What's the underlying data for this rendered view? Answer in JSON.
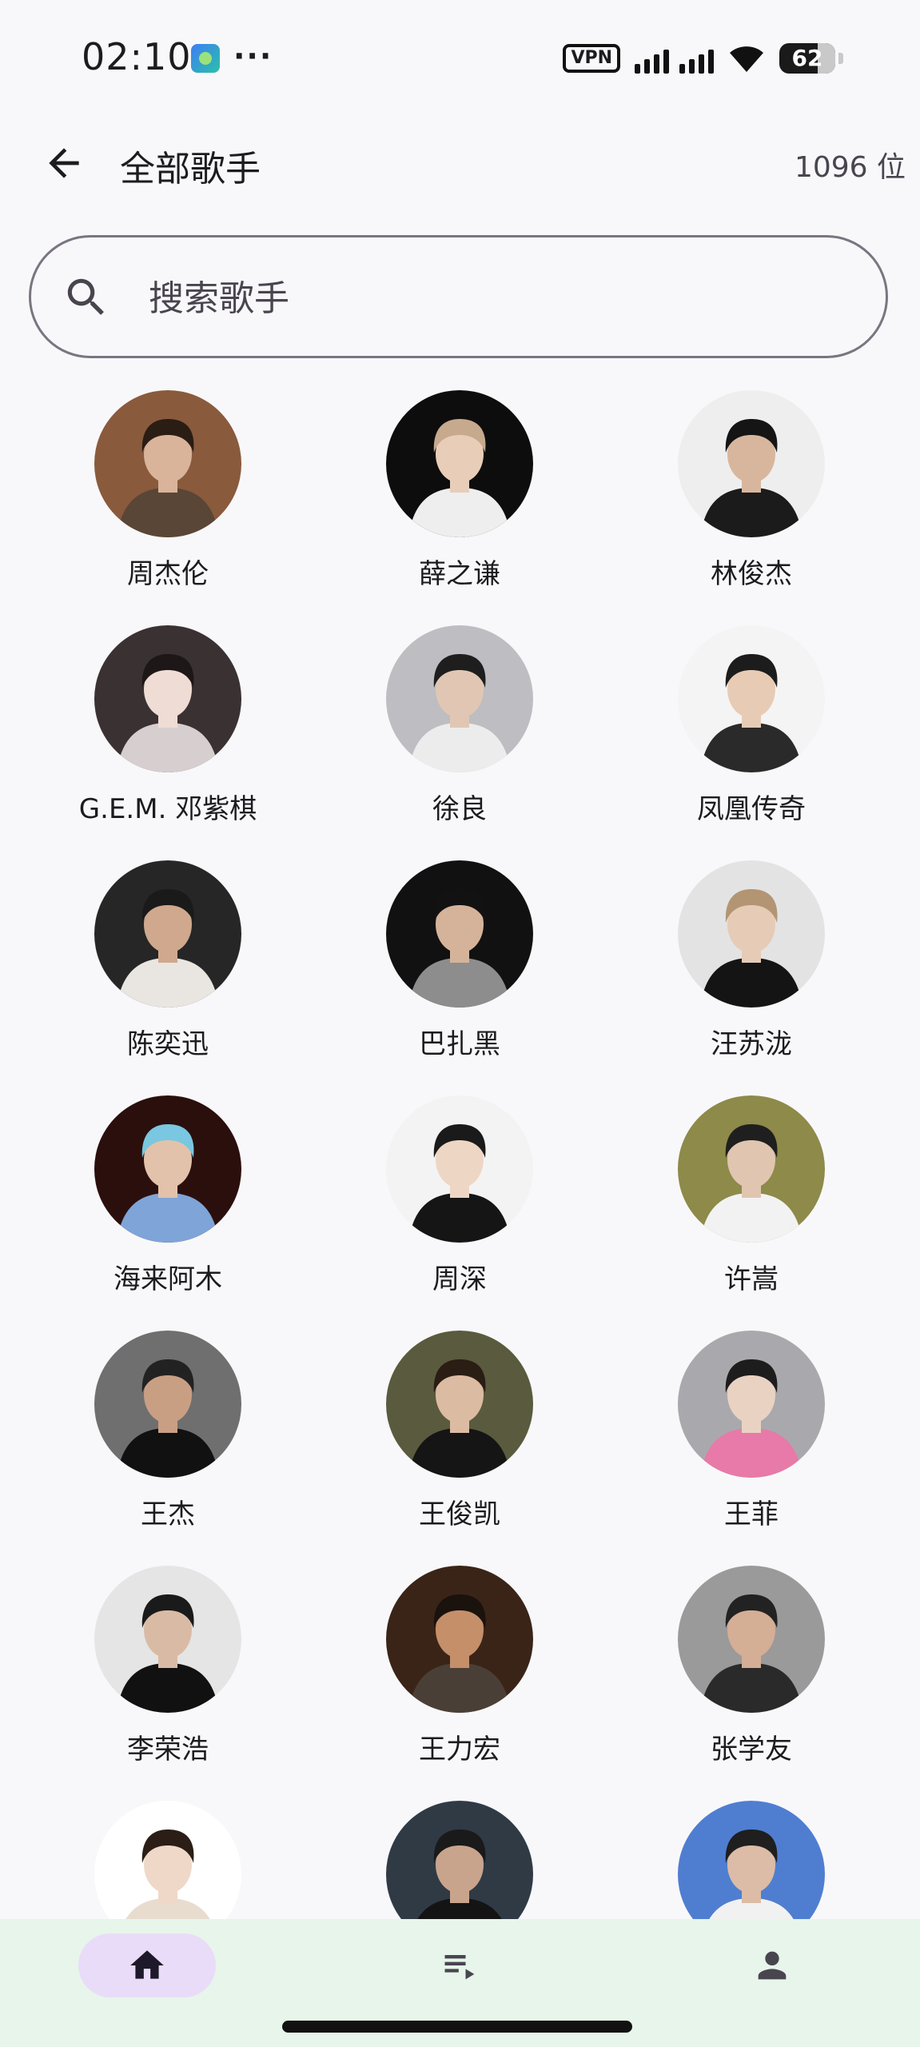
{
  "status_bar": {
    "time": "02:10",
    "more": "···",
    "vpn": "VPN",
    "battery": "62"
  },
  "header": {
    "title": "全部歌手",
    "count": "1096 位"
  },
  "search": {
    "placeholder": "搜索歌手",
    "value": ""
  },
  "artists": [
    {
      "name": "周杰伦",
      "bg": "#8a5a3c",
      "body": "#5a4636",
      "hair": "#2a1d14",
      "skin": "#d9b49a"
    },
    {
      "name": "薛之谦",
      "bg": "#0d0d0d",
      "body": "#eeeeee",
      "hair": "#c7a98d",
      "skin": "#e8cdb8"
    },
    {
      "name": "林俊杰",
      "bg": "#eeeeee",
      "body": "#1b1b1b",
      "hair": "#151515",
      "skin": "#d8b69e"
    },
    {
      "name": "G.E.M. 邓紫棋",
      "bg": "#3a3133",
      "body": "#d7cfcf",
      "hair": "#1d1718",
      "skin": "#efdcd4"
    },
    {
      "name": "徐良",
      "bg": "#bdbdc2",
      "body": "#ececec",
      "hair": "#1e1e1e",
      "skin": "#e1c7b3"
    },
    {
      "name": "凤凰传奇",
      "bg": "#f4f4f4",
      "body": "#2a2a2a",
      "hair": "#1c1c1c",
      "skin": "#e8cbb5"
    },
    {
      "name": "陈奕迅",
      "bg": "#262626",
      "body": "#e9e6e1",
      "hair": "#1a1a1a",
      "skin": "#cfa88e"
    },
    {
      "name": "巴扎黑",
      "bg": "#111111",
      "body": "#8d8d8d",
      "hair": "#121212",
      "skin": "#d5b39a"
    },
    {
      "name": "汪苏泷",
      "bg": "#e3e3e3",
      "body": "#141414",
      "hair": "#b39574",
      "skin": "#e6cbb6"
    },
    {
      "name": "海来阿木",
      "bg": "#2b0f0d",
      "body": "#7fa4d8",
      "hair": "#79c7e0",
      "skin": "#e2c2aa"
    },
    {
      "name": "周深",
      "bg": "#f3f3f3",
      "body": "#151515",
      "hair": "#1a1a1a",
      "skin": "#eed6c4"
    },
    {
      "name": "许嵩",
      "bg": "#8d8a4a",
      "body": "#f2f2f2",
      "hair": "#1f1f1f",
      "skin": "#e0c5b0"
    },
    {
      "name": "王杰",
      "bg": "#6f6f6f",
      "body": "#111111",
      "hair": "#222222",
      "skin": "#c99f84"
    },
    {
      "name": "王俊凯",
      "bg": "#5a5a3e",
      "body": "#151515",
      "hair": "#2a1d14",
      "skin": "#dcbba3"
    },
    {
      "name": "王菲",
      "bg": "#a9a9ad",
      "body": "#e77aa8",
      "hair": "#1d1d1d",
      "skin": "#ead2c3"
    },
    {
      "name": "李荣浩",
      "bg": "#e5e5e5",
      "body": "#111111",
      "hair": "#1a1a1a",
      "skin": "#d9bba5"
    },
    {
      "name": "王力宏",
      "bg": "#3a2418",
      "body": "#4a3f36",
      "hair": "#1a120d",
      "skin": "#c58f6a"
    },
    {
      "name": "张学友",
      "bg": "#9a9a9a",
      "body": "#2a2a2a",
      "hair": "#222222",
      "skin": "#d4ae95"
    },
    {
      "name": "",
      "bg": "#ffffff",
      "body": "#e8dccf",
      "hair": "#2a1e16",
      "skin": "#efd8c7"
    },
    {
      "name": "",
      "bg": "#2f3a45",
      "body": "#141414",
      "hair": "#1a1a1a",
      "skin": "#c9a48d"
    },
    {
      "name": "",
      "bg": "#4f7ed1",
      "body": "#f1f1f1",
      "hair": "#1f1f1f",
      "skin": "#dcbca6"
    }
  ],
  "nav": {
    "home_label": "首页",
    "playlist_label": "播放列表",
    "profile_label": "我的"
  },
  "colors": {
    "background": "#f8f8fa",
    "nav_background": "#e7f5ea",
    "nav_active": "#e9dcf8"
  }
}
